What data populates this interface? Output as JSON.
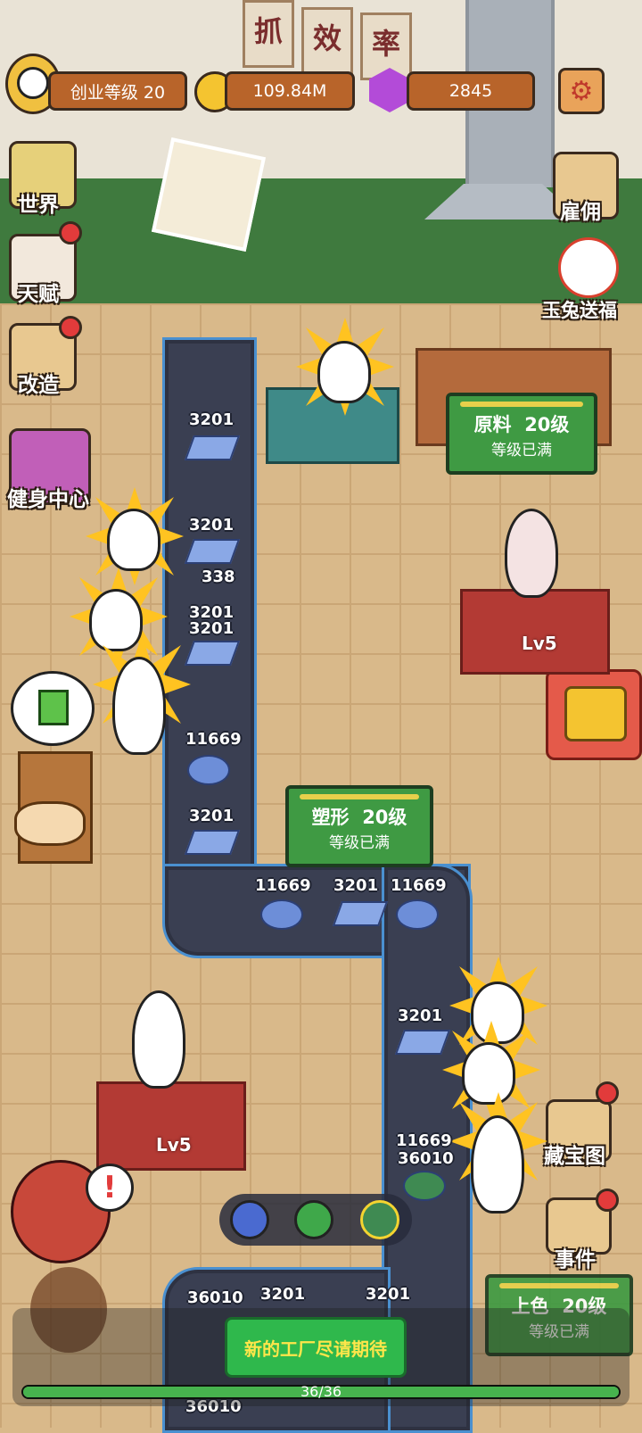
{
  "hud": {
    "level_label": "创业等级 20",
    "coins": "109.84M",
    "gems": "2845",
    "settings_icon": "gear-icon"
  },
  "banner_chars": [
    "抓",
    "效",
    "率"
  ],
  "left_menu": [
    {
      "label": "世界",
      "icon": "world-map-icon",
      "badge": false
    },
    {
      "label": "天赋",
      "icon": "talent-icon",
      "badge": true
    },
    {
      "label": "改造",
      "icon": "remodel-icon",
      "badge": true
    },
    {
      "label": "健身中心",
      "icon": "gym-icon",
      "badge": false
    }
  ],
  "right_menu": [
    {
      "label": "雇佣",
      "icon": "hire-icon",
      "badge": false
    },
    {
      "label": "玉兔送福",
      "icon": "jade-rabbit-icon",
      "badge": false
    },
    {
      "label": "藏宝图",
      "icon": "treasure-map-icon",
      "badge": true
    },
    {
      "label": "事件",
      "icon": "event-icon",
      "badge": true
    }
  ],
  "stations": [
    {
      "name": "原料",
      "level": "20级",
      "status": "等级已满"
    },
    {
      "name": "塑形",
      "level": "20级",
      "status": "等级已满"
    },
    {
      "name": "上色",
      "level": "20级",
      "status": "等级已满"
    }
  ],
  "managers": [
    {
      "level": "Lv5"
    },
    {
      "level": "Lv5"
    }
  ],
  "belt_numbers": {
    "n1": "3201",
    "n2": "3201",
    "n3": "338",
    "n4": "3201",
    "n5": "3201",
    "n6": "11669",
    "n7": "3201",
    "n8": "11669",
    "n9": "3201",
    "n10": "11669",
    "n11": "3201",
    "n12": "11669",
    "n13": "36010",
    "n14": "36010",
    "n15": "3201",
    "n16": "3201",
    "n17": "36010"
  },
  "bottom": {
    "coming_soon": "新的工厂尽请期待",
    "progress_text": "36/36",
    "progress_fraction": 1.0
  },
  "colors": {
    "accent": "#b8642a",
    "station": "#3f9a43",
    "belt_edge": "#4a90d0",
    "badge": "#e23b3b"
  }
}
